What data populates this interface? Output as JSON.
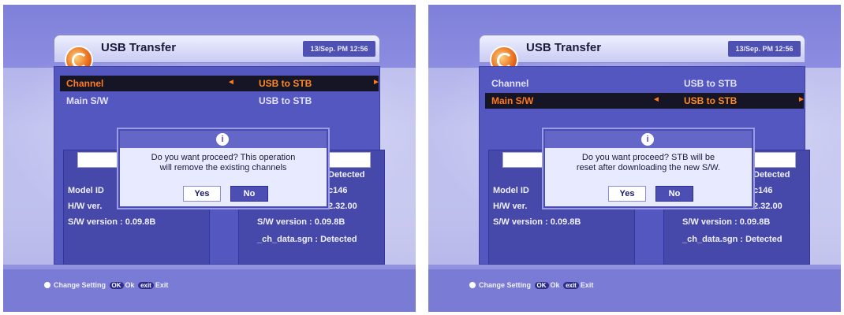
{
  "screens": [
    {
      "header": {
        "title": "USB Transfer",
        "datetime": "13/Sep. PM 12:56"
      },
      "rows": [
        {
          "label": "Channel",
          "value": "USB to STB"
        },
        {
          "label": "Main S/W",
          "value": "USB to STB"
        }
      ],
      "selected_row": "Channel",
      "left_info": {
        "model": "Model ID",
        "hw": "H/W ver.",
        "sw": "S/W version : 0.09.8B"
      },
      "right_info": {
        "detected": "Detected",
        "model": "c146",
        "hw": "2.32.00",
        "sw": "S/W version : 0.09.8B",
        "chdata": "_ch_data.sgn : Detected"
      },
      "dialog": {
        "icon": "info-icon",
        "line1": "Do you want proceed? This operation",
        "line2": "will remove the existing channels",
        "yes": "Yes",
        "no": "No",
        "focused": "No"
      },
      "footer": {
        "change": "Change Setting",
        "ok_key": "OK",
        "ok": "Ok",
        "exit_key": "exit",
        "exit": "Exit"
      }
    },
    {
      "header": {
        "title": "USB Transfer",
        "datetime": "13/Sep. PM 12:56"
      },
      "rows": [
        {
          "label": "Channel",
          "value": "USB to STB"
        },
        {
          "label": "Main S/W",
          "value": "USB to STB"
        }
      ],
      "selected_row": "Main S/W",
      "left_info": {
        "model": "Model ID",
        "hw": "H/W ver.",
        "sw": "S/W version : 0.09.8B"
      },
      "right_info": {
        "detected": "Detected",
        "model": "c146",
        "hw": "2.32.00",
        "sw": "S/W version : 0.09.8B",
        "chdata": "_ch_data.sgn : Detected"
      },
      "dialog": {
        "icon": "info-icon",
        "line1": "Do you want proceed? STB will be",
        "line2": "reset after downloading the new S/W.",
        "yes": "Yes",
        "no": "No",
        "focused": "No"
      },
      "footer": {
        "change": "Change Setting",
        "ok_key": "OK",
        "ok": "Ok",
        "exit_key": "exit",
        "exit": "Exit"
      }
    }
  ],
  "colors": {
    "selected_text": "#ff7a1a",
    "panel": "#5557c0",
    "dialog_bg": "#e8eaff"
  }
}
